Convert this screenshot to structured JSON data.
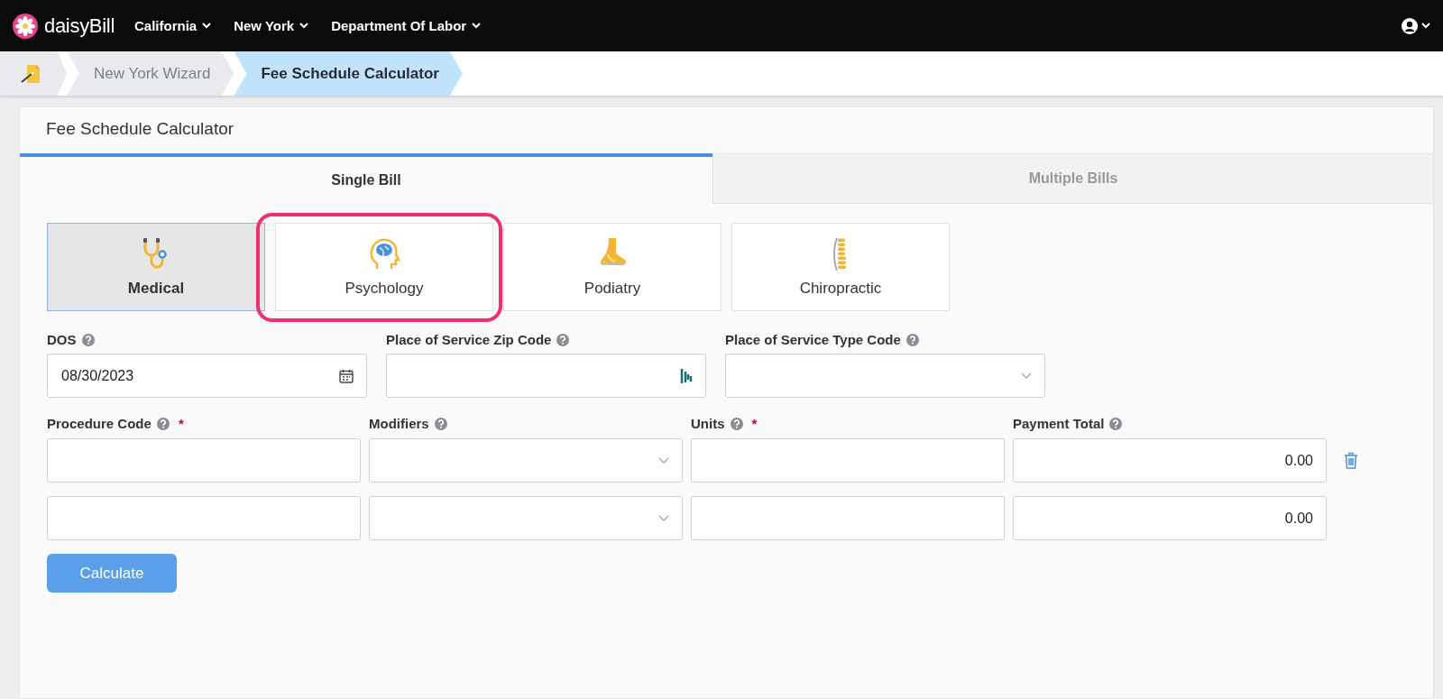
{
  "top_nav": {
    "logo": "daisy**Bill**",
    "menus": [
      {
        "label": "California"
      },
      {
        "label": "New York"
      },
      {
        "label": "Department Of Labor"
      }
    ]
  },
  "breadcrumbs": [
    {
      "label": "New York Wizard",
      "selected": false
    },
    {
      "label": "Fee Schedule Calculator",
      "selected": true
    }
  ],
  "panel": {
    "title": "Fee Schedule Calculator",
    "tabs": [
      {
        "label": "Single Bill",
        "selected": true
      },
      {
        "label": "Multiple Bills",
        "selected": false
      }
    ],
    "categories": [
      {
        "label": "Medical",
        "kind": "stethoscope",
        "selected": true,
        "highlighted": false
      },
      {
        "label": "Psychology",
        "kind": "brain",
        "selected": false,
        "highlighted": true
      },
      {
        "label": "Podiatry",
        "kind": "foot",
        "selected": false,
        "highlighted": false
      },
      {
        "label": "Chiropractic",
        "kind": "spine",
        "selected": false,
        "highlighted": false
      }
    ],
    "fields": [
      {
        "label": "DOS",
        "kind": "date",
        "value": "08/30/2023"
      },
      {
        "label": "Place of Service Zip Code",
        "kind": "lookup"
      },
      {
        "label": "Place of Service Type Code",
        "kind": "select"
      }
    ],
    "line_columns": [
      {
        "label": "Procedure Code",
        "required_mark": "*"
      },
      {
        "label": "Modifiers"
      },
      {
        "label": "Units",
        "required_mark": "*"
      },
      {
        "label": "Payment Total"
      }
    ],
    "lines": [
      {
        "payment_total": "0.00",
        "removable": true
      },
      {
        "payment_total": "0.00",
        "removable": false
      }
    ],
    "button": "Calculate"
  }
}
